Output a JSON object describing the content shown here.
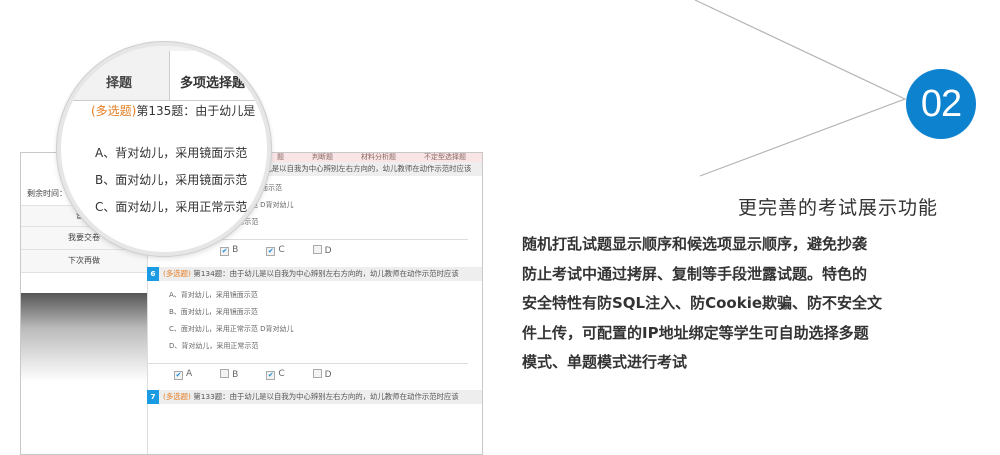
{
  "badge": {
    "number": "02",
    "color": "#0d82cf"
  },
  "feature": {
    "title": "更完善的考试展示功能",
    "lines": [
      "随机打乱试题显示顺序和候选项显示顺序，避免抄袭",
      "防止考试中通过拷屏、复制等手段泄露试题。特色的",
      "安全特性有防SQL注入、防Cookie欺骗、防不安全文",
      "件上传，可配置的IP地址绑定等学生可自助选择多题",
      "模式、单题模式进行考试"
    ]
  },
  "sidebar": {
    "timer_icon": "alarm-clock-icon",
    "remaining": "剩余时间：99分3",
    "buttons": [
      "暂停",
      "我要交卷",
      "下次再做"
    ]
  },
  "tabs": [
    "题",
    "判断题",
    "材料分析题",
    "不定型选择题"
  ],
  "magnifier": {
    "tab_single": "择题",
    "tab_multi": "多项选择题",
    "question_tag": "(多选题)",
    "question_text": "第135题：由于幼儿是",
    "options": [
      "A、背对幼儿，采用镜面示范",
      "B、面对幼儿，采用镜面示范",
      "C、面对幼儿，采用正常示范"
    ]
  },
  "q135": {
    "header": "幼儿是以自我为中心辨别左右方向的，幼儿教师在动作示范时应该",
    "options": [
      "",
      "用镜面示范",
      "C、面对幼儿，采用正常示范 D背对幼儿",
      "D、背对幼儿，采用正常示范"
    ],
    "answers": [
      {
        "label": "A",
        "checked": false
      },
      {
        "label": "B",
        "checked": true
      },
      {
        "label": "C",
        "checked": true
      },
      {
        "label": "D",
        "checked": false
      }
    ]
  },
  "q134": {
    "number": "6",
    "tag": "(多选题)",
    "text": "第134题：由于幼儿是以自我为中心辨别左右方向的，幼儿教师在动作示范时应该",
    "options": [
      "A、背对幼儿，采用镜面示范",
      "B、面对幼儿，采用镜面示范",
      "C、面对幼儿，采用正常示范 D背对幼儿",
      "D、背对幼儿，采用正常示范"
    ],
    "answers": [
      {
        "label": "A",
        "checked": true
      },
      {
        "label": "B",
        "checked": false
      },
      {
        "label": "C",
        "checked": true
      },
      {
        "label": "D",
        "checked": false
      }
    ]
  },
  "q133": {
    "number": "7",
    "tag": "(多选题)",
    "text": "第133题：由于幼儿是以自我为中心辨别左右方向的，幼儿教师在动作示范时应该"
  }
}
